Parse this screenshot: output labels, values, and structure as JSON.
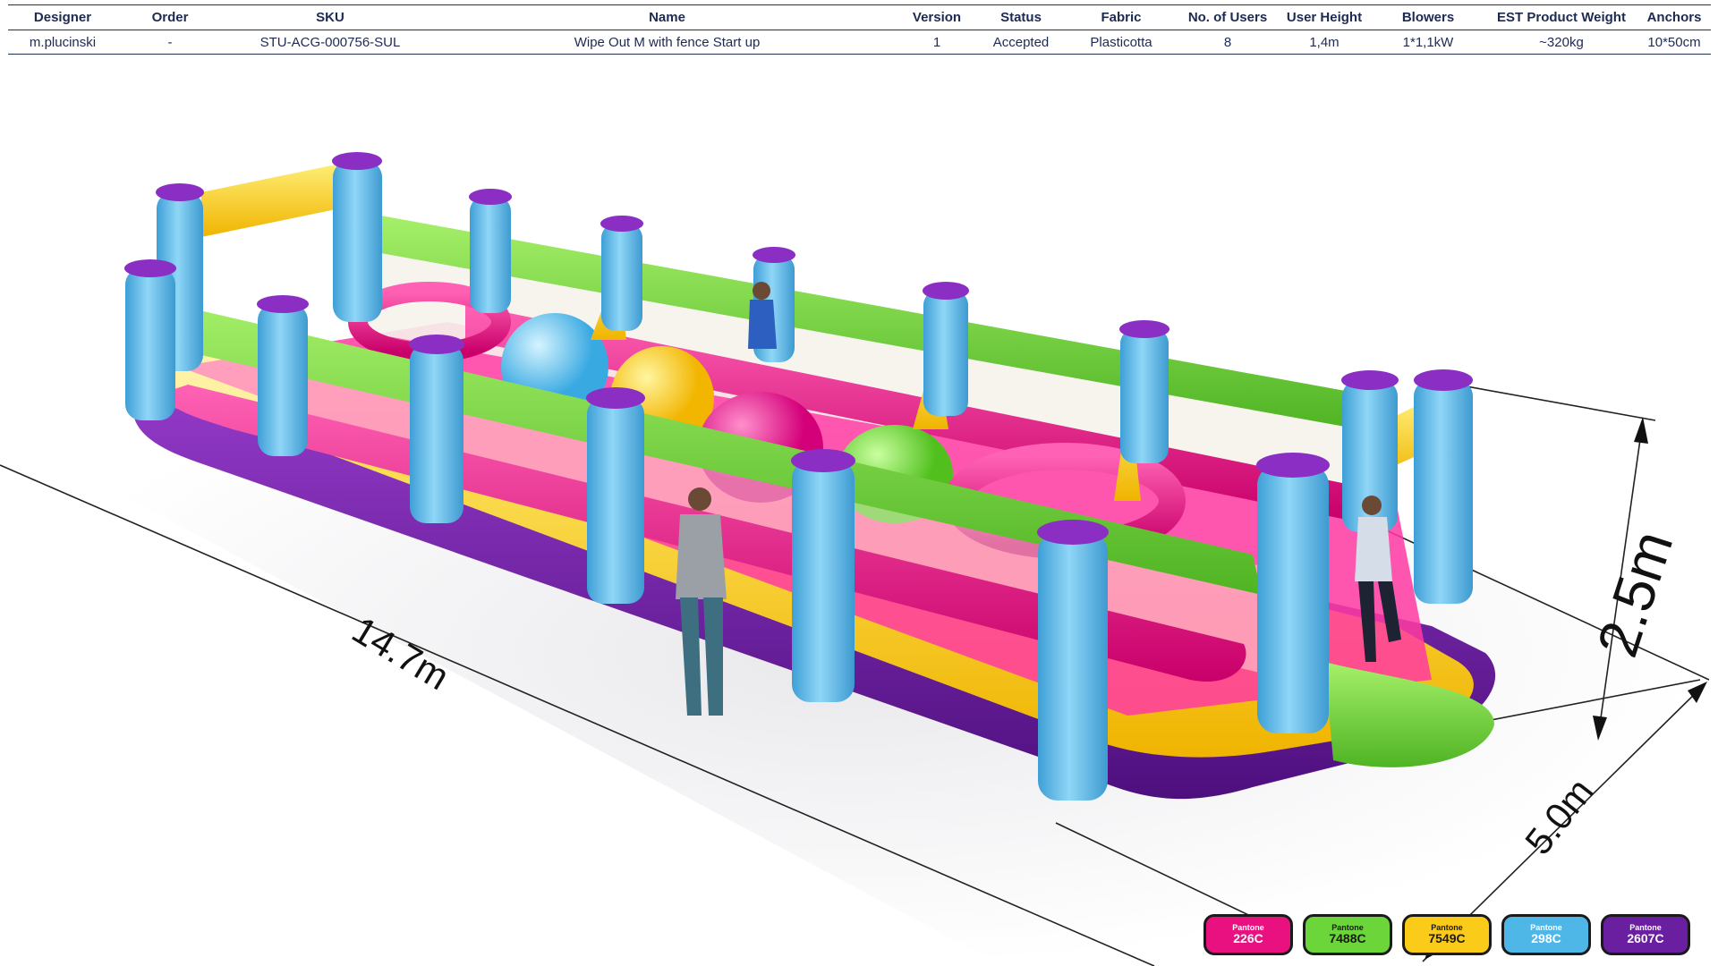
{
  "spec": {
    "headers": [
      "Designer",
      "Order",
      "SKU",
      "Name",
      "Version",
      "Status",
      "Fabric",
      "No. of Users",
      "User  Height",
      "Blowers",
      "EST Product Weight",
      "Anchors"
    ],
    "row": [
      "m.plucinski",
      "-",
      "STU-ACG-000756-SUL",
      "Wipe Out M with fence Start up",
      "1",
      "Accepted",
      "Plasticotta",
      "8",
      "1,4m",
      "1*1,1kW",
      "~320kg",
      "10*50cm"
    ]
  },
  "dimensions": {
    "length": "14.7m",
    "height": "2.5m",
    "width": "5.0m"
  },
  "swatches": [
    {
      "brand": "Pantone",
      "code": "226C",
      "color": "#e8117f"
    },
    {
      "brand": "Pantone",
      "code": "7488C",
      "color": "#6bd53a"
    },
    {
      "brand": "Pantone",
      "code": "7549C",
      "color": "#fbcb1a"
    },
    {
      "brand": "Pantone",
      "code": "298C",
      "color": "#4fb7e8"
    },
    {
      "brand": "Pantone",
      "code": "2607C",
      "color": "#6a1fa0"
    }
  ]
}
